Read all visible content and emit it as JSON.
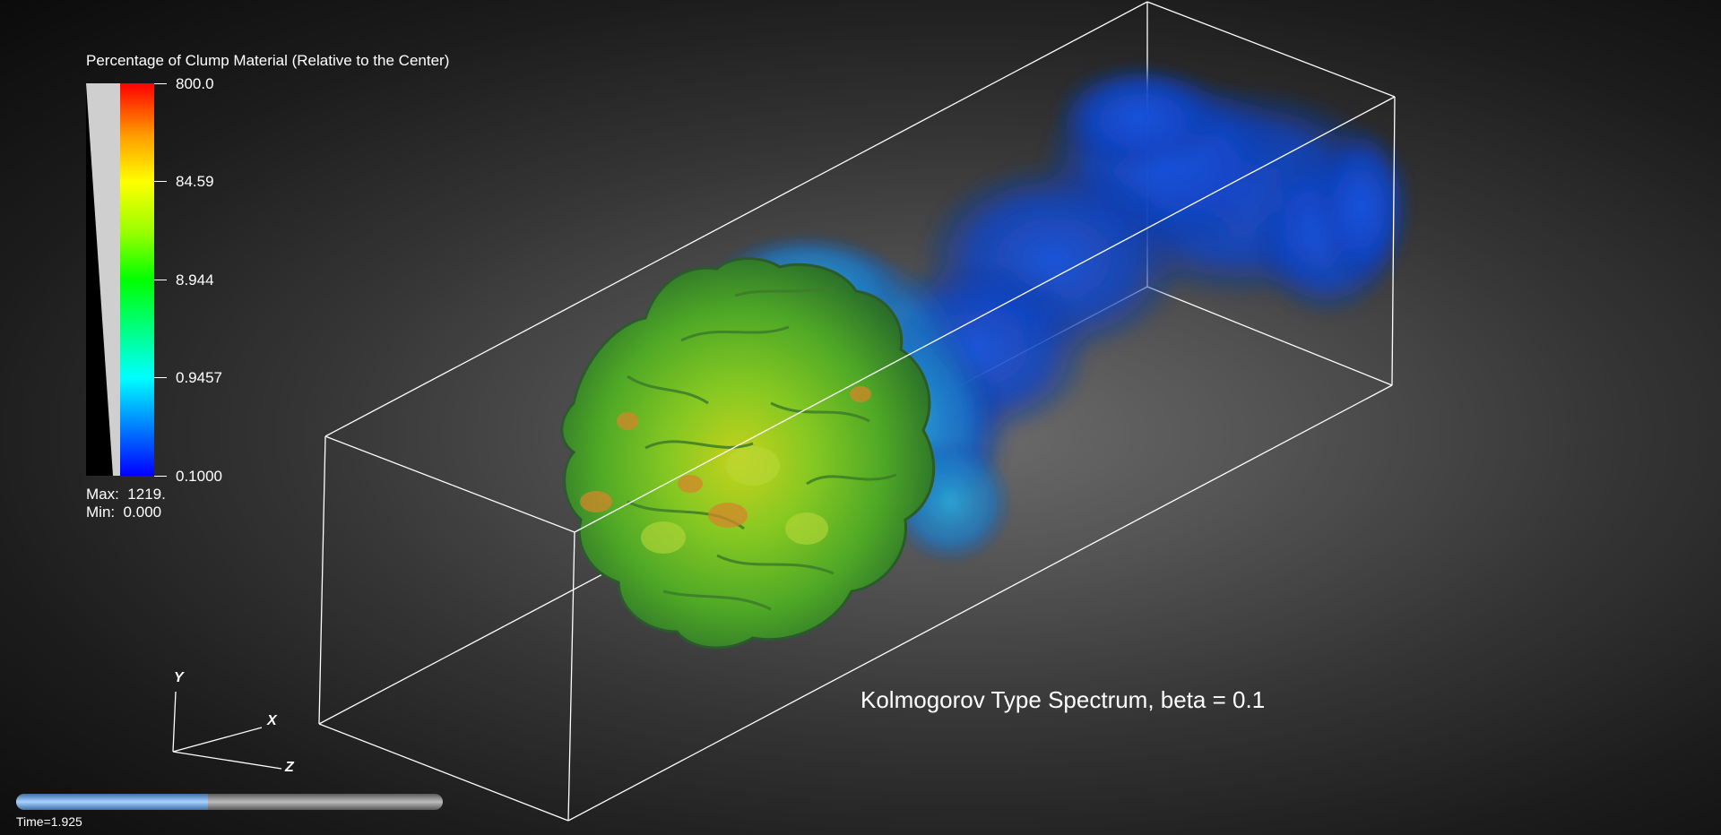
{
  "legend": {
    "title": "Percentage of Clump Material (Relative to the Center)",
    "ticks": [
      "800.0",
      "84.59",
      "8.944",
      "0.9457",
      "0.1000"
    ],
    "max_label": "Max:  1219.",
    "min_label": "Min:  0.000",
    "colormap": [
      "#0000ff",
      "#00ffff",
      "#00ff00",
      "#ffff00",
      "#ff0000"
    ]
  },
  "caption": "Kolmogorov Type Spectrum, beta = 0.1",
  "axes": {
    "y": "Y",
    "x": "X",
    "z": "Z"
  },
  "timeline": {
    "label": "Time=1.925",
    "progress": 0.45
  },
  "colors": {
    "box_outline": "#ffffff",
    "progress_fill": "#9ccaff"
  }
}
